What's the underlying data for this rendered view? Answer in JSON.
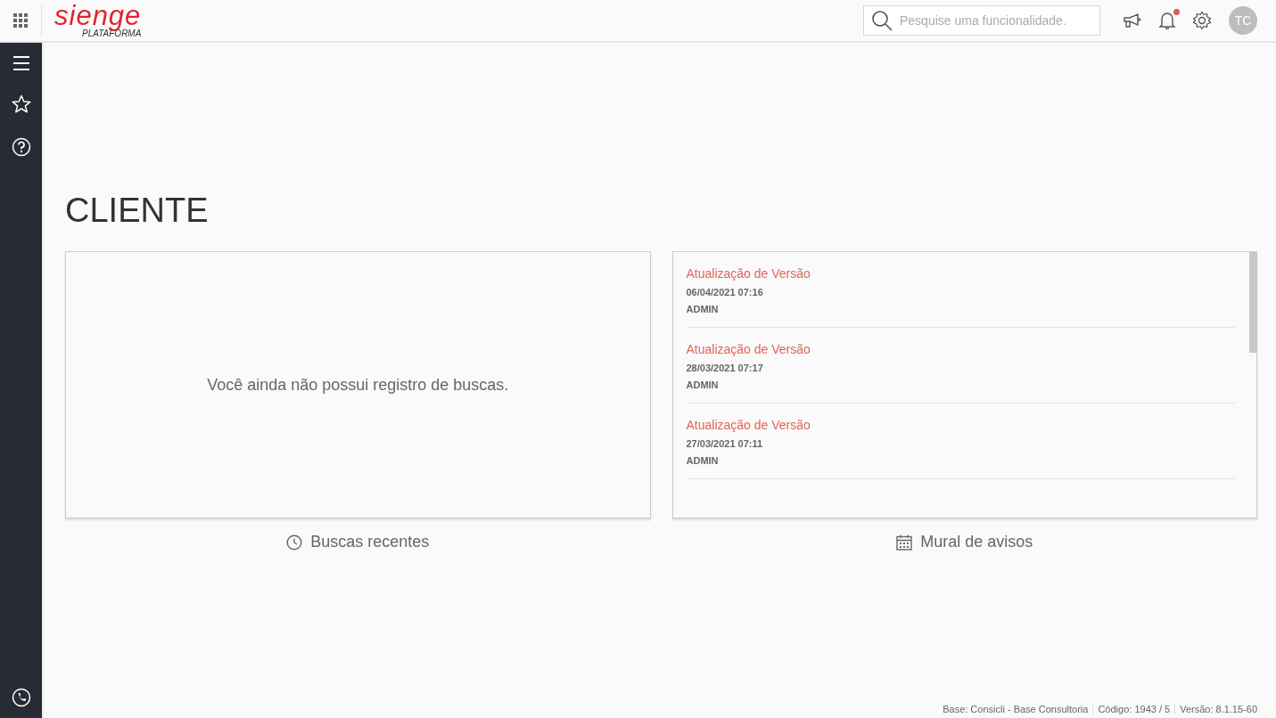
{
  "header": {
    "logo": {
      "wordmark": "sienge",
      "subtitle": "PLATAFORMA"
    },
    "search": {
      "placeholder": "Pesquise uma funcionalidade."
    },
    "notifications": {
      "unread": true
    },
    "avatar": {
      "initials": "TC"
    }
  },
  "page": {
    "title": "CLIENTE"
  },
  "recent_searches": {
    "empty_message": "Você ainda não possui registro de buscas.",
    "caption": "Buscas recentes"
  },
  "notice_board": {
    "caption": "Mural de avisos",
    "items": [
      {
        "title": "Atualização de Versão",
        "date": "06/04/2021 07:16",
        "author": "ADMIN"
      },
      {
        "title": "Atualização de Versão",
        "date": "28/03/2021 07:17",
        "author": "ADMIN"
      },
      {
        "title": "Atualização de Versão",
        "date": "27/03/2021 07:11",
        "author": "ADMIN"
      }
    ]
  },
  "footer": [
    "Base: Consicli - Base Consultoria",
    "Código: 1943 / 5",
    "Versão: 8.1.15-60"
  ]
}
